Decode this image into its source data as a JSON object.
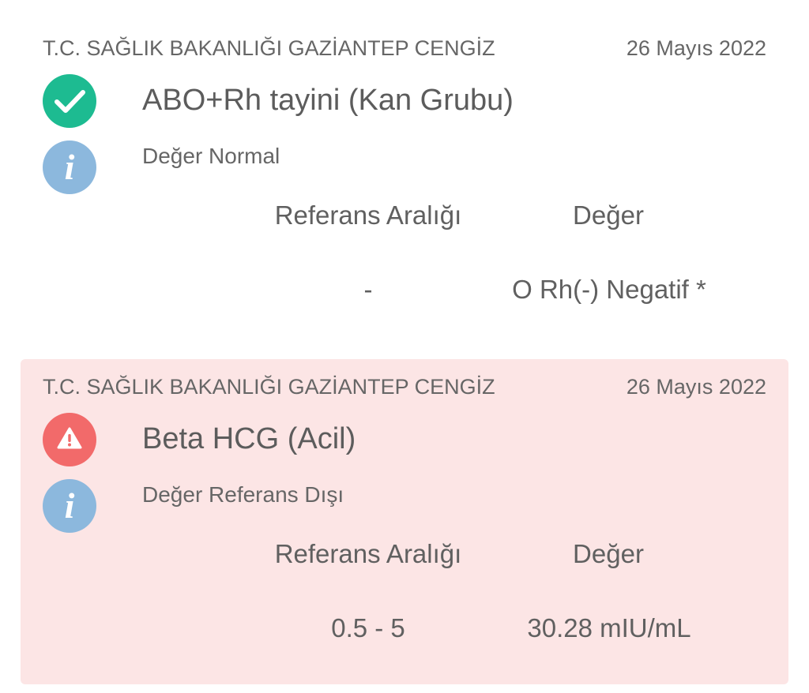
{
  "results": [
    {
      "hospital": "T.C. SAĞLIK BAKANLIĞI GAZİANTEP CENGİZ",
      "date": "26 Mayıs 2022",
      "status_icon": "check-icon",
      "test_name": "ABO+Rh tayini (Kan Grubu)",
      "status_text": "Değer Normal",
      "reference_header": "Referans Aralığı",
      "value_header": "Değer",
      "reference_range": "-",
      "value": "O Rh(-) Negatif *",
      "background": "#ffffff",
      "icon_color": "#1dbb91"
    },
    {
      "hospital": "T.C. SAĞLIK BAKANLIĞI GAZİANTEP CENGİZ",
      "date": "26 Mayıs 2022",
      "status_icon": "warning-icon",
      "test_name": "Beta HCG (Acil)",
      "status_text": "Değer Referans Dışı",
      "reference_header": "Referans Aralığı",
      "value_header": "Değer",
      "reference_range": "0.5 - 5",
      "value": "30.28 mIU/mL",
      "background": "#fce5e5",
      "icon_color": "#f26a6a"
    }
  ],
  "info_glyph": "i",
  "info_icon_color": "#8cb8dd"
}
